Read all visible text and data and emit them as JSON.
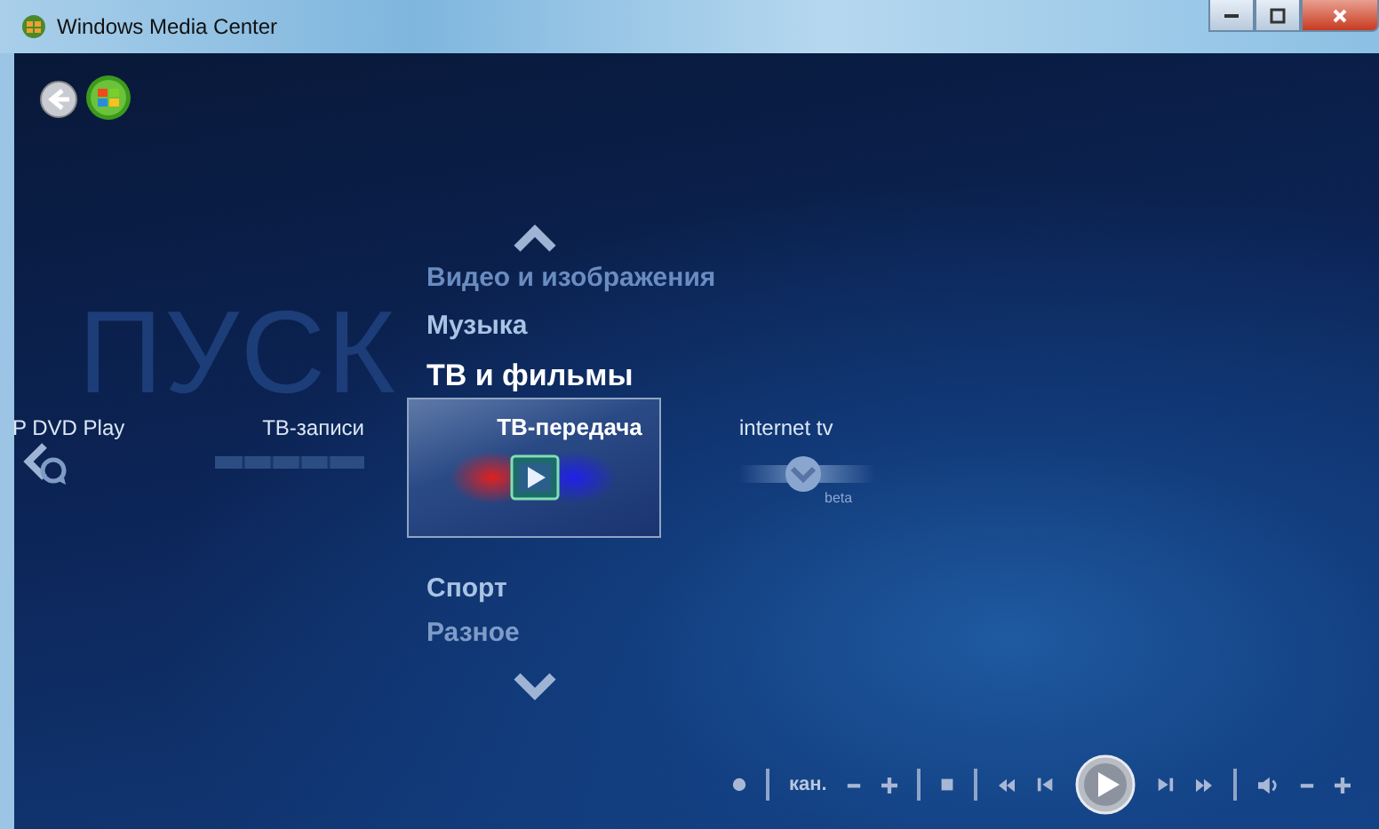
{
  "window": {
    "title": "Windows Media Center"
  },
  "page_title": "ПУСК",
  "menu": [
    {
      "label": "Видео и изображения",
      "selected": false
    },
    {
      "label": "Музыка",
      "selected": false
    },
    {
      "label": "ТВ и фильмы",
      "selected": true
    },
    {
      "label": "Спорт",
      "selected": false
    },
    {
      "label": "Разное",
      "selected": false
    }
  ],
  "strip": [
    {
      "label": "P DVD Play",
      "kind": "dvd",
      "selected": false
    },
    {
      "label": "ТВ-записи",
      "kind": "recorded",
      "selected": false
    },
    {
      "label": "ТВ-передача",
      "kind": "live",
      "selected": true
    },
    {
      "label": "internet tv",
      "kind": "internet",
      "selected": false,
      "badge": "beta"
    }
  ],
  "transport": {
    "channel_label": "кан."
  }
}
